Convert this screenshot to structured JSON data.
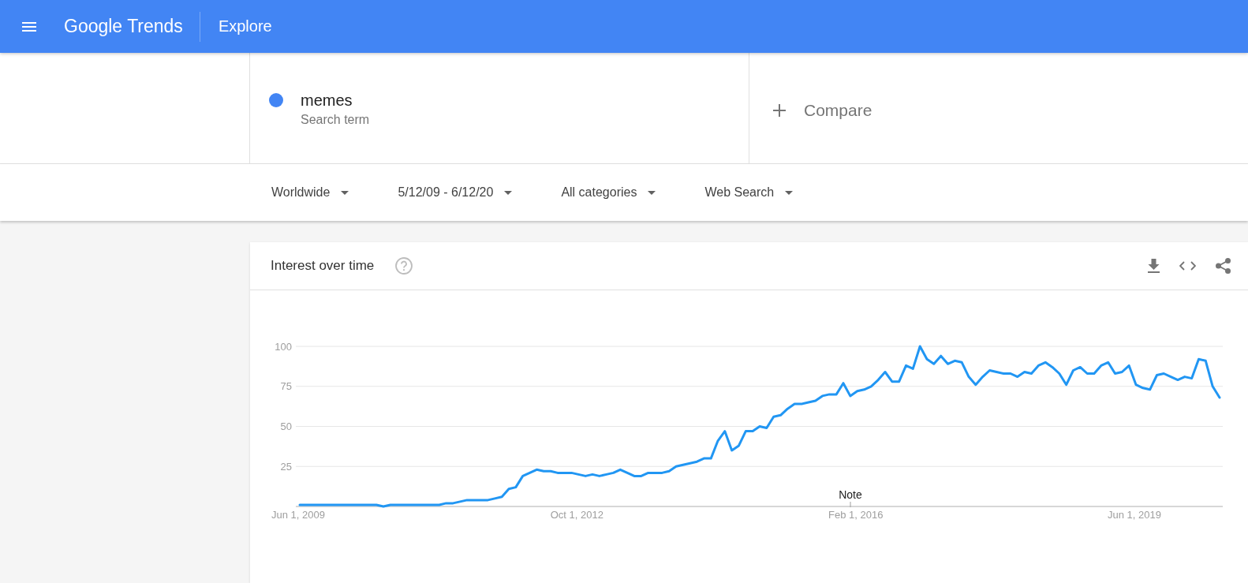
{
  "header": {
    "logo": "Google Trends",
    "page_title": "Explore"
  },
  "search_terms": [
    {
      "term": "memes",
      "subtitle": "Search term",
      "color": "#4285f4"
    }
  ],
  "compare": {
    "label": "Compare"
  },
  "filters": [
    "Worldwide",
    "5/12/09 - 6/12/20",
    "All categories",
    "Web Search"
  ],
  "interest_card": {
    "title": "Interest over time",
    "chart_data": {
      "type": "line",
      "grid": true,
      "categories": [
        "Jun 1, 2009",
        null,
        null,
        null,
        null,
        null,
        null,
        null,
        null,
        null,
        null,
        null,
        null,
        null,
        null,
        null,
        null,
        null,
        null,
        null,
        null,
        null,
        null,
        null,
        null,
        null,
        null,
        null,
        null,
        null,
        null,
        null,
        null,
        null,
        null,
        null,
        null,
        null,
        null,
        null,
        "Oct 1, 2012",
        null,
        null,
        null,
        null,
        null,
        null,
        null,
        null,
        null,
        null,
        null,
        null,
        null,
        null,
        null,
        null,
        null,
        null,
        null,
        null,
        null,
        null,
        null,
        null,
        null,
        null,
        null,
        null,
        null,
        null,
        null,
        null,
        null,
        null,
        null,
        null,
        null,
        null,
        null,
        "Feb 1, 2016",
        null,
        null,
        null,
        null,
        null,
        null,
        null,
        null,
        null,
        null,
        null,
        null,
        null,
        null,
        null,
        null,
        null,
        null,
        null,
        null,
        null,
        null,
        null,
        null,
        null,
        null,
        null,
        null,
        null,
        null,
        null,
        null,
        null,
        null,
        null,
        null,
        null,
        null,
        null,
        "Jun 1, 2019",
        null,
        null,
        null,
        null,
        null,
        null,
        null,
        null,
        null,
        null,
        null,
        null
      ],
      "ylim": [
        0,
        100
      ],
      "yticks": [
        25,
        50,
        75,
        100
      ],
      "series": [
        {
          "color": "#2196f3",
          "values": [
            1,
            1,
            1,
            1,
            1,
            1,
            1,
            1,
            1,
            1,
            1,
            1,
            0,
            1,
            1,
            1,
            1,
            1,
            1,
            1,
            1,
            2,
            2,
            3,
            4,
            4,
            4,
            4,
            5,
            6,
            11,
            12,
            19,
            21,
            23,
            22,
            22,
            21,
            21,
            21,
            20,
            19,
            20,
            19,
            20,
            21,
            23,
            21,
            19,
            19,
            21,
            21,
            21,
            22,
            25,
            26,
            27,
            28,
            30,
            30,
            41,
            47,
            35,
            38,
            47,
            47,
            50,
            49,
            56,
            57,
            61,
            64,
            64,
            65,
            66,
            69,
            70,
            70,
            77,
            69,
            72,
            73,
            75,
            79,
            84,
            78,
            78,
            88,
            86,
            100,
            92,
            89,
            94,
            89,
            91,
            90,
            81,
            76,
            81,
            85,
            84,
            83,
            83,
            81,
            84,
            83,
            88,
            90,
            87,
            83,
            76,
            85,
            87,
            83,
            83,
            88,
            90,
            83,
            84,
            88,
            76,
            74,
            73,
            82,
            83,
            81,
            79,
            81,
            80,
            92,
            91,
            75,
            68
          ]
        }
      ],
      "annotations": [
        "Note"
      ]
    }
  }
}
